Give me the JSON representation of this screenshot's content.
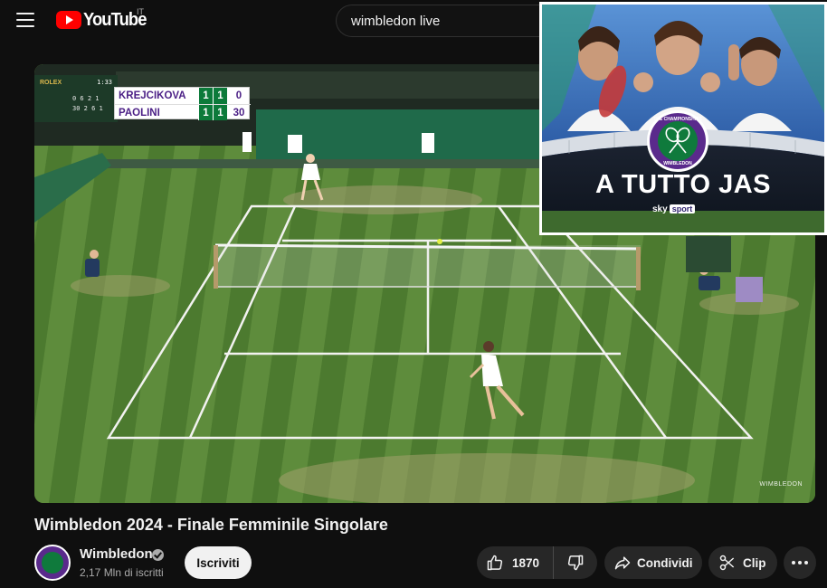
{
  "header": {
    "logo_text": "YouTube",
    "country_code": "IT",
    "search_value": "wimbledon live"
  },
  "player": {
    "scoreboard": {
      "players": [
        {
          "name": "KREJCIKOVA",
          "set1": "1",
          "set2": "1",
          "points": "0"
        },
        {
          "name": "PAOLINI",
          "set1": "1",
          "set2": "1",
          "points": "30"
        }
      ]
    },
    "clock_board": {
      "brand": "ROLEX",
      "time": "1:33",
      "row1": "0 6 2 1",
      "row2": "30 2 6 1"
    },
    "watermark": "WIMBLEDON"
  },
  "promo_overlay": {
    "title": "A TUTTO JAS",
    "broadcaster": "sky",
    "broadcaster_tag": "sport",
    "seal_top": "THE CHAMPIONSHIPS",
    "seal_bottom": "WIMBLEDON"
  },
  "video": {
    "title": "Wimbledon 2024 - Finale Femminile Singolare",
    "channel_name": "Wimbledon",
    "subscribers": "2,17 Mln di iscritti",
    "subscribe_label": "Iscriviti",
    "like_count": "1870",
    "share_label": "Condividi",
    "clip_label": "Clip"
  },
  "colors": {
    "background": "#0f0f0f",
    "brand_red": "#ff0000",
    "pill_bg": "#272727",
    "wimbledon_purple": "#5a2a8c",
    "wimbledon_green": "#0f7a3c"
  }
}
